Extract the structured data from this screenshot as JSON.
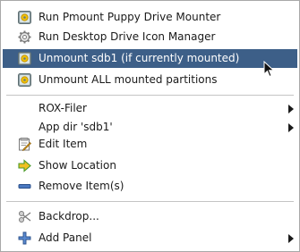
{
  "menu": {
    "items": [
      {
        "label": "Run Pmount Puppy Drive Mounter",
        "icon": "drive-mounter-icon"
      },
      {
        "label": "Run Desktop Drive Icon Manager",
        "icon": "gear-icon"
      },
      {
        "label": "Unmount sdb1 (if currently mounted)",
        "icon": "drive-mounter-icon"
      },
      {
        "label": "Unmount ALL mounted partitions",
        "icon": "drive-mounter-icon"
      },
      {
        "label": "ROX-Filer"
      },
      {
        "label": "App dir 'sdb1'"
      },
      {
        "label": "Edit Item",
        "icon": "edit-icon"
      },
      {
        "label": "Show Location",
        "icon": "arrow-right-icon"
      },
      {
        "label": "Remove Item(s)",
        "icon": "remove-icon"
      },
      {
        "label": "Backdrop...",
        "icon": "backdrop-icon"
      },
      {
        "label": "Add Panel",
        "icon": "add-icon"
      }
    ]
  },
  "colors": {
    "highlight": "#3d5f88",
    "text": "#1a1a1a",
    "separator": "#c4c4c4"
  }
}
